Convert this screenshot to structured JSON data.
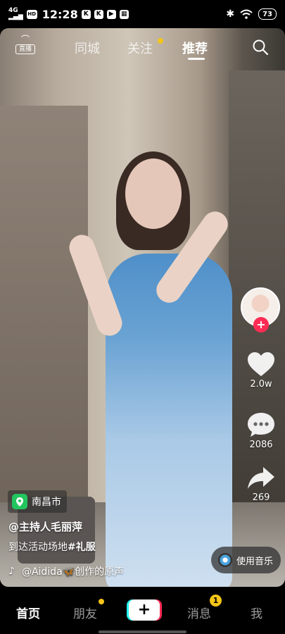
{
  "status_bar": {
    "network": "4G",
    "hd": "HD",
    "time": "12:28",
    "battery": "73"
  },
  "top_tabs": {
    "live": "直播",
    "items": [
      "同城",
      "关注",
      "推荐"
    ],
    "active": "推荐"
  },
  "actions": {
    "likes": "2.0w",
    "comments": "2086",
    "shares": "269"
  },
  "video_info": {
    "location": "南昌市",
    "author": "@主持人毛丽萍",
    "description": "到达活动场地",
    "hashtag": "#礼服",
    "music": "@Aidida🦋创作的原声",
    "use_music": "使用音乐"
  },
  "bottom_nav": {
    "home": "首页",
    "friends": "朋友",
    "post": "+",
    "messages": "消息",
    "messages_badge": "1",
    "me": "我"
  },
  "colors": {
    "accent_red": "#fe2c55",
    "accent_cyan": "#25f4ee",
    "badge_yellow": "#f5c518",
    "location_green": "#22c55e"
  }
}
